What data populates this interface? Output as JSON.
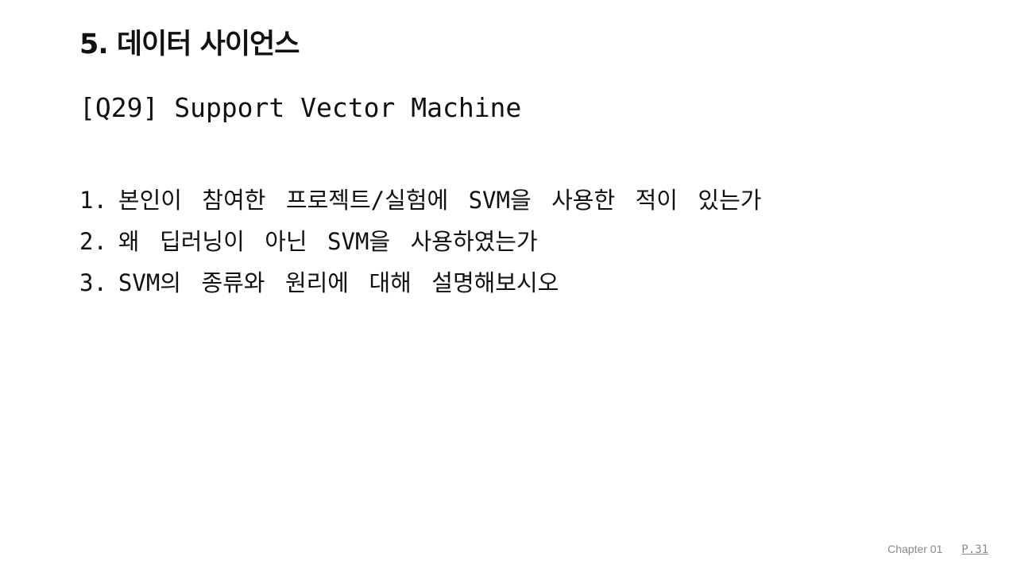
{
  "section": {
    "title": "5. 데이터 사이언스"
  },
  "question": {
    "title": "[Q29] Support Vector Machine",
    "items": [
      {
        "number": "1.",
        "text": "본인이 참여한 프로젝트/실험에 SVM을 사용한 적이 있는가"
      },
      {
        "number": "2.",
        "text": "왜 딥러닝이 아닌 SVM을 사용하였는가"
      },
      {
        "number": "3.",
        "text": "SVM의 종류와 원리에 대해 설명해보시오"
      }
    ]
  },
  "footer": {
    "chapter": "Chapter 01",
    "page": "P.31"
  },
  "colors": {
    "text": "#111111",
    "footer": "#8a8a8a",
    "background": "#ffffff"
  }
}
